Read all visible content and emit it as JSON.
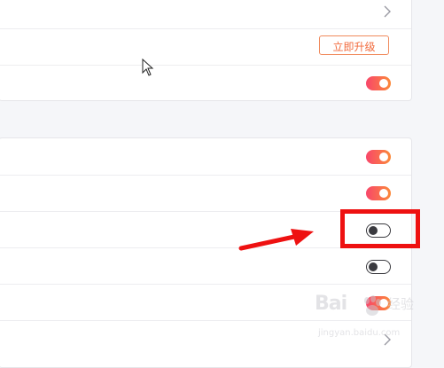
{
  "upgrade_button": {
    "label": "立即升级"
  },
  "watermark": {
    "brand": "Bai",
    "brand_cn": "经验",
    "url": "jingyan.baidu.com"
  },
  "toggles": [
    {
      "name": "toggle-row-3",
      "state": "on"
    },
    {
      "name": "toggle-row-4",
      "state": "on"
    },
    {
      "name": "toggle-row-5",
      "state": "on"
    },
    {
      "name": "toggle-row-6",
      "state": "off"
    },
    {
      "name": "toggle-row-7",
      "state": "off"
    },
    {
      "name": "toggle-row-8",
      "state": "on"
    }
  ],
  "colors": {
    "accent_start": "#f8466a",
    "accent_end": "#fb8a3a",
    "highlight": "#ee1111",
    "upgrade_text": "#f26a3c"
  },
  "icons": [
    "chevron-right-icon",
    "mouse-cursor-icon",
    "red-arrow-icon",
    "paw-logo-icon"
  ]
}
